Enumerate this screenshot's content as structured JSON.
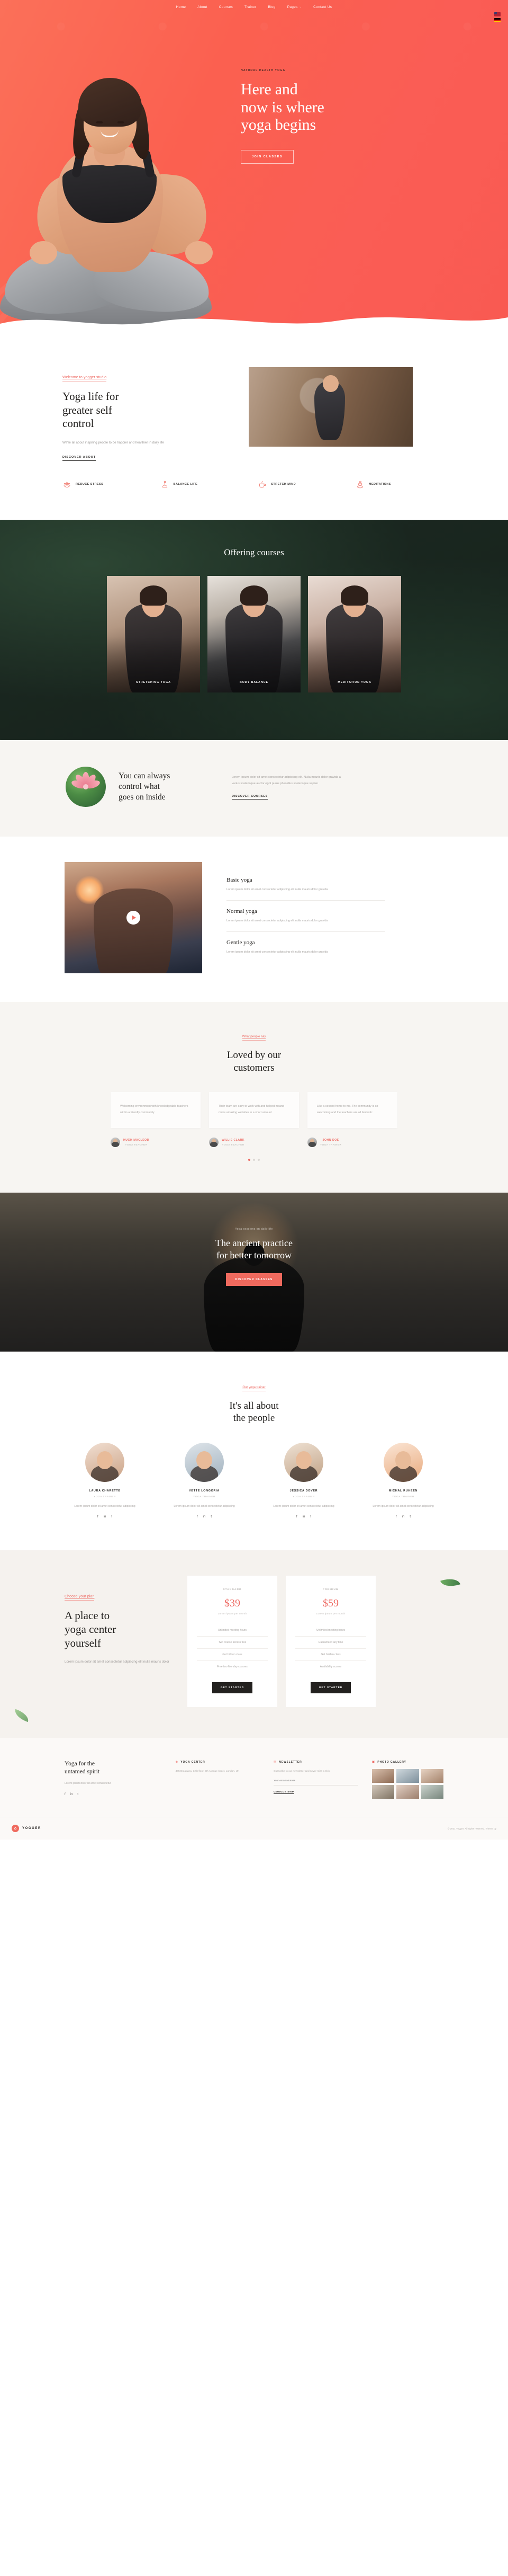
{
  "nav": {
    "items": [
      {
        "label": "Home",
        "active": true
      },
      {
        "label": "About",
        "active": false
      },
      {
        "label": "Courses",
        "active": false
      },
      {
        "label": "Trainer",
        "active": false
      },
      {
        "label": "Blog",
        "active": false
      },
      {
        "label": "Pages",
        "active": false,
        "caret": "⌄"
      },
      {
        "label": "Contact Us",
        "active": false
      }
    ]
  },
  "hero": {
    "eyebrow": "NATURAL HEALTH YOGA",
    "line1": "Here and",
    "line2": "now is where",
    "line3": "yoga begins",
    "cta": "JOIN CLASSES",
    "bg_color": "#fb6050"
  },
  "about": {
    "eyebrow": "Welcome to yogger studio",
    "title_line1": "Yoga life for",
    "title_line2": "greater self",
    "title_line3": "control",
    "body": "We're all about inspiring people to be happier and healthier in daily life",
    "link": "DISCOVER ABOUT",
    "features": [
      {
        "icon": "lotus-icon",
        "label": "REDUCE STRESS"
      },
      {
        "icon": "meditation-figure-icon",
        "label": "BALANCE LIFE"
      },
      {
        "icon": "tea-cup-icon",
        "label": "STRETCH MIND"
      },
      {
        "icon": "stacked-stones-icon",
        "label": "MEDITATIONS"
      }
    ]
  },
  "courses": {
    "title": "Offering courses",
    "cards": [
      {
        "label": "STRETCHING YOGA"
      },
      {
        "label": "BODY BALANCE"
      },
      {
        "label": "MEDITATION YOGA"
      }
    ]
  },
  "control": {
    "title_line1": "You can always",
    "title_line2": "control what",
    "title_line3": "goes on inside",
    "body": "Lorem ipsum dolor sit amet consectetur adipiscing elit. Nulla mauris dolor gravida a varius scelerisque auctor egot purus phasellus scelerisque sapien",
    "link": "DISCOVER COURSES"
  },
  "types": {
    "play_label": "play-button",
    "items": [
      {
        "title": "Basic yoga",
        "desc": "Lorem ipsum dolor sit amet consectetur adipiscing elit nulla mauris dolor gravida"
      },
      {
        "title": "Normal yoga",
        "desc": "Lorem ipsum dolor sit amet consectetur adipiscing elit nulla mauris dolor gravida"
      },
      {
        "title": "Gentle yoga",
        "desc": "Lorem ipsum dolor sit amet consectetur adipiscing elit nulla mauris dolor gravida"
      }
    ]
  },
  "testimonials": {
    "eyebrow": "What people say",
    "title_line1": "Loved by our",
    "title_line2": "customers",
    "cards": [
      {
        "text": "Welcoming environment with knowledgeable teachers within a friendly community",
        "name": "HUGH MACLEOD",
        "role": "YOGA TEACHER"
      },
      {
        "text": "Their team are easy to work with and helped meand make amazing websites in a short amount",
        "name": "WILLIE CLARK",
        "role": "YOGA TEACHER"
      },
      {
        "text": "Like a second home to me. The community is so welcoming and the teachers are all fantastic",
        "name": "JOHN DOE",
        "role": "YOGA TRAINER"
      }
    ],
    "dots": 3,
    "active_dot": 0
  },
  "ancient": {
    "eyebrow": "Yoga sessions on daily life",
    "title_line1": "The ancient practice",
    "title_line2": "for better tomorrow",
    "cta": "DISCOVER CLASSES"
  },
  "people": {
    "eyebrow": "Our yoga trainer",
    "title_line1": "It's all about",
    "title_line2": "the people",
    "members": [
      {
        "name": "LAURA CHARETTE",
        "role": "YOGA TRAINER",
        "desc": "Lorem ipsum dolor sit amet consectetur adipiscing",
        "social": [
          "f",
          "in",
          "t"
        ]
      },
      {
        "name": "VETTE LONGORIA",
        "role": "YOGA TRAINER",
        "desc": "Lorem ipsum dolor sit amet consectetur adipiscing",
        "social": [
          "f",
          "in",
          "t"
        ]
      },
      {
        "name": "JESSICA DOVER",
        "role": "YOGA TRAINER",
        "desc": "Lorem ipsum dolor sit amet consectetur adipiscing",
        "social": [
          "f",
          "in",
          "t"
        ]
      },
      {
        "name": "MICHAL RUHEEN",
        "role": "YOGA TRAINER",
        "desc": "Lorem ipsum dolor sit amet consectetur adipiscing",
        "social": [
          "f",
          "in",
          "t"
        ]
      }
    ]
  },
  "pricing": {
    "eyebrow": "Choose your plan",
    "title_line1": "A place to",
    "title_line2": "yoga center",
    "title_line3": "yourself",
    "body": "Lorem ipsum dolor sit amet consectetur adipiscing elit nulla mauris dolor",
    "plans": [
      {
        "tag": "STANDARD",
        "amount": "$39",
        "per": "Lorem ipsum per month",
        "features": [
          "Unlimited meeting hours",
          "Two course access free",
          "Get hidden class",
          "Free two Monday courses"
        ],
        "cta": "GET STARTED"
      },
      {
        "tag": "PREMIUM",
        "amount": "$59",
        "per": "Lorem ipsum per month",
        "features": [
          "Unlimited meeting hours",
          "Guaranteed any time",
          "Get hidden class",
          "Availability access"
        ],
        "cta": "GET STARTED"
      }
    ]
  },
  "footer": {
    "heading_line1": "Yoga for the",
    "heading_line2": "untamed spirit",
    "sub": "Lorem ipsum dolor sit amet consectetur",
    "social": [
      "f",
      "in",
      "t"
    ],
    "col_center": {
      "icon": "location-pin-icon",
      "title": "YOGA CENTER",
      "text": "485 Broadway, 12th floor, 5th Avenue street, London, UK"
    },
    "col_newsletter": {
      "icon": "envelope-icon",
      "title": "NEWSLETTER",
      "text": "Subscribe to our newsletter and never miss a trick",
      "placeholder": "Your email address",
      "send_label": "GOOGLE MAP"
    },
    "col_gallery": {
      "icon": "camera-icon",
      "title": "PHOTO GALLERY"
    },
    "brand": "YOGGER",
    "brand_mark": "✿",
    "copyright": "© 2021 Yogger. All rights reserved. Theme by"
  }
}
